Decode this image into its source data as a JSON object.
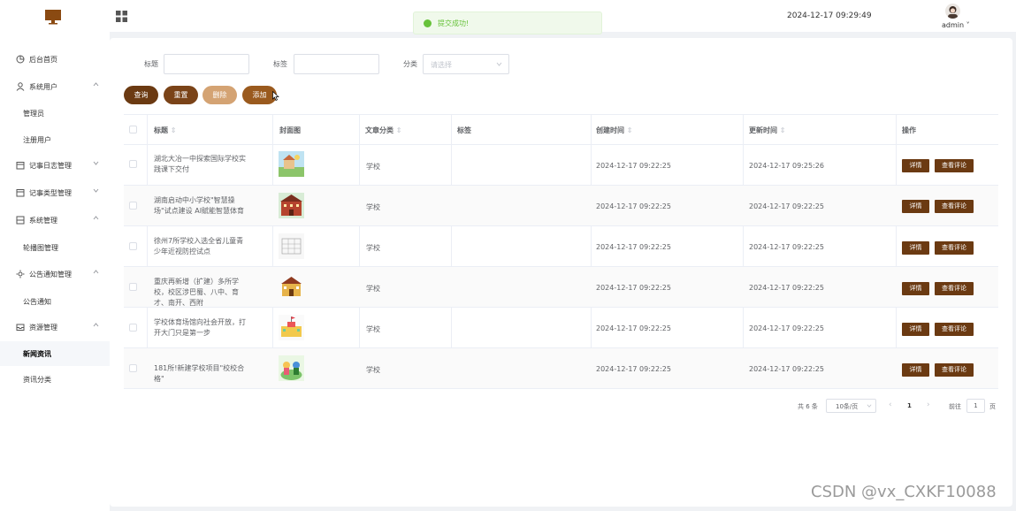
{
  "header": {
    "datetime": "2024-12-17 09:29:49",
    "user": "admin ˅"
  },
  "toast": {
    "message": "提交成功!"
  },
  "sidebar": {
    "items": [
      {
        "label": "后台首页",
        "icon": "pie-chart-icon",
        "type": "top"
      },
      {
        "label": "系统用户",
        "icon": "user-icon",
        "type": "top",
        "arrow": "up"
      },
      {
        "label": "管理员",
        "type": "sub"
      },
      {
        "label": "注册用户",
        "type": "sub"
      },
      {
        "label": "记事日志管理",
        "icon": "calendar-icon",
        "type": "top",
        "arrow": "down"
      },
      {
        "label": "记事类型管理",
        "icon": "calendar-icon",
        "type": "top",
        "arrow": "down"
      },
      {
        "label": "系统管理",
        "icon": "cabinet-icon",
        "type": "top",
        "arrow": "up"
      },
      {
        "label": "轮播图管理",
        "type": "sub"
      },
      {
        "label": "公告通知管理",
        "icon": "sun-icon",
        "type": "top",
        "arrow": "up"
      },
      {
        "label": "公告通知",
        "type": "sub"
      },
      {
        "label": "资源管理",
        "icon": "inbox-icon",
        "type": "top",
        "arrow": "up"
      },
      {
        "label": "新闻资讯",
        "type": "sub",
        "active": true
      },
      {
        "label": "资讯分类",
        "type": "sub"
      }
    ]
  },
  "search": {
    "title_label": "标题",
    "tag_label": "标签",
    "category_label": "分类",
    "category_placeholder": "请选择"
  },
  "buttons": {
    "query": "查询",
    "reset": "重置",
    "delete": "删除",
    "add": "添加"
  },
  "colors": {
    "query": "#6b3a12",
    "reset": "#7a4318",
    "delete": "#d4a373",
    "add": "#9a5a1e"
  },
  "table": {
    "headers": {
      "title": "标题",
      "cover": "封面图",
      "category": "文章分类",
      "tag": "标签",
      "created": "创建时间",
      "updated": "更新时间",
      "ops": "操作"
    },
    "rows": [
      {
        "title": "湖北大冶一中探索国际学校实践课下交付",
        "category": "学校",
        "tag": "",
        "created": "2024-12-17 09:22:25",
        "updated": "2024-12-17 09:25:26",
        "cover": "landscape-thumbnail"
      },
      {
        "title": "湖南启动中小学校\"智慧操场\"试点建设 AI赋能智慧体育",
        "category": "学校",
        "tag": "",
        "created": "2024-12-17 09:22:25",
        "updated": "2024-12-17 09:22:25",
        "cover": "school-building-thumbnail"
      },
      {
        "title": "徐州7所学校入选全省儿童青少年近视防控试点",
        "category": "学校",
        "tag": "",
        "created": "2024-12-17 09:22:25",
        "updated": "2024-12-17 09:22:25",
        "cover": "sketch-thumbnail"
      },
      {
        "title": "重庆再新增（扩建）多所学校，校区涉巴蜀、八中、育才、南开、西附",
        "category": "学校",
        "tag": "",
        "created": "2024-12-17 09:22:25",
        "updated": "2024-12-17 09:22:25",
        "cover": "school-house-thumbnail"
      },
      {
        "title": "学校体育场馆向社会开放，打开大门只是第一步",
        "category": "学校",
        "tag": "",
        "created": "2024-12-17 09:22:25",
        "updated": "2024-12-17 09:22:25",
        "cover": "school-flag-thumbnail"
      },
      {
        "title": "181所!新建学校项目\"校校合格\"",
        "category": "学校",
        "tag": "",
        "created": "2024-12-17 09:22:25",
        "updated": "2024-12-17 09:22:25",
        "cover": "kids-thumbnail"
      }
    ],
    "detail_label": "详情",
    "comment_label": "查看评论"
  },
  "pagination": {
    "total": "共 6 条",
    "page_size": "10条/页",
    "current_page": "1",
    "goto_prefix": "前往",
    "goto_value": "1",
    "goto_suffix": "页"
  },
  "watermark": "CSDN @vx_CXKF10088"
}
